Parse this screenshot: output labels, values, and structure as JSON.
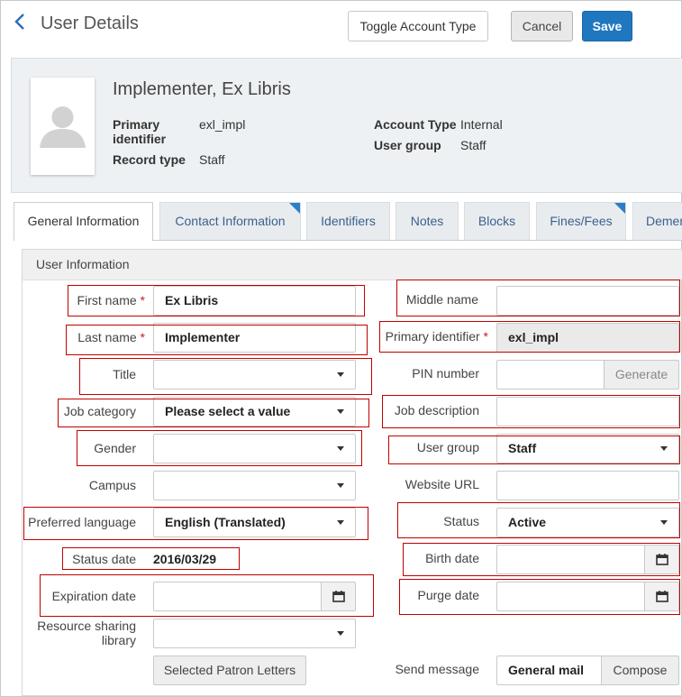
{
  "header": {
    "title": "User Details",
    "toggle_label": "Toggle Account Type",
    "cancel_label": "Cancel",
    "save_label": "Save"
  },
  "summary": {
    "name": "Implementer, Ex Libris",
    "primary_identifier_label": "Primary identifier",
    "primary_identifier_value": "exl_impl",
    "record_type_label": "Record type",
    "record_type_value": "Staff",
    "account_type_label": "Account Type",
    "account_type_value": "Internal",
    "user_group_label": "User group",
    "user_group_value": "Staff"
  },
  "tabs": [
    {
      "label": "General Information",
      "active": true
    },
    {
      "label": "Contact Information",
      "flag": true
    },
    {
      "label": "Identifiers"
    },
    {
      "label": "Notes"
    },
    {
      "label": "Blocks"
    },
    {
      "label": "Fines/Fees",
      "flag": true
    },
    {
      "label": "Demer"
    }
  ],
  "section": {
    "title": "User Information"
  },
  "fields": {
    "first_name": {
      "label": "First name",
      "value": "Ex Libris"
    },
    "middle_name": {
      "label": "Middle name",
      "value": ""
    },
    "last_name": {
      "label": "Last name",
      "value": "Implementer"
    },
    "primary_identifier": {
      "label": "Primary identifier",
      "value": "exl_impl"
    },
    "title": {
      "label": "Title",
      "value": ""
    },
    "pin_number": {
      "label": "PIN number",
      "value": "",
      "generate_label": "Generate"
    },
    "job_category": {
      "label": "Job category",
      "value": "Please select a value"
    },
    "job_description": {
      "label": "Job description",
      "value": ""
    },
    "gender": {
      "label": "Gender",
      "value": ""
    },
    "user_group": {
      "label": "User group",
      "value": "Staff"
    },
    "campus": {
      "label": "Campus",
      "value": ""
    },
    "website_url": {
      "label": "Website URL",
      "value": ""
    },
    "preferred_language": {
      "label": "Preferred language",
      "value": "English (Translated)"
    },
    "status": {
      "label": "Status",
      "value": "Active"
    },
    "status_date": {
      "label": "Status date",
      "value": "2016/03/29"
    },
    "birth_date": {
      "label": "Birth date",
      "value": ""
    },
    "expiration_date": {
      "label": "Expiration date",
      "value": ""
    },
    "purge_date": {
      "label": "Purge date",
      "value": ""
    },
    "resource_sharing_library": {
      "label_line1": "Resource sharing",
      "label_line2": "library",
      "value": ""
    },
    "selected_patron_letters_label": "Selected Patron Letters",
    "send_message": {
      "label": "Send message",
      "value": "General mail",
      "compose_label": "Compose"
    }
  },
  "required_marker": "*",
  "colors": {
    "accent": "#1f77c0",
    "required": "#c51f1f",
    "highlight_box": "#c00000",
    "tab_flag": "#2a7fc8"
  }
}
